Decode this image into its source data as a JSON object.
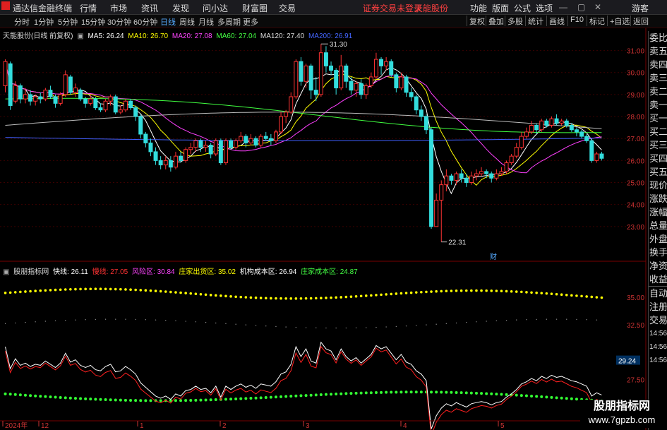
{
  "app": {
    "title": "通达信金融终端"
  },
  "menu": [
    "行情",
    "市场",
    "资讯",
    "发现",
    "问小达",
    "财富圈",
    "交易"
  ],
  "warning": "证券交易未登录",
  "stock_name_top": "天能股份",
  "right_menu": [
    "功能",
    "版面",
    "公式",
    "选项"
  ],
  "guest": "游客",
  "periods": [
    "分时",
    "1分钟",
    "5分钟",
    "15分钟",
    "30分钟",
    "60分钟",
    "日线",
    "周线",
    "月线",
    "多周期",
    "更多"
  ],
  "active_period": "日线",
  "tools": [
    "复权",
    "叠加",
    "多股",
    "统计",
    "画线",
    "F10",
    "标记",
    "+自选",
    "返回"
  ],
  "main_header": {
    "title": "天能股份(日线 前复权)",
    "ma": [
      {
        "label": "MA5: 26.24",
        "color": "#ffffff"
      },
      {
        "label": "MA10: 26.70",
        "color": "#ffff00"
      },
      {
        "label": "MA20: 27.08",
        "color": "#ff40ff"
      },
      {
        "label": "MA60: 27.04",
        "color": "#40ff40"
      },
      {
        "label": "MA120: 27.40",
        "color": "#dddddd"
      },
      {
        "label": "MA200: 26.91",
        "color": "#4060ff"
      }
    ]
  },
  "price_axis": [
    "31.00",
    "30.00",
    "29.00",
    "28.00",
    "27.00",
    "26.00",
    "25.00",
    "24.00",
    "23.00"
  ],
  "high_label": "31.30",
  "low_label": "22.31",
  "cai_label": "财",
  "ind_header": {
    "name": "股朋指标网",
    "items": [
      {
        "label": "快线: 26.11",
        "color": "#ffffff"
      },
      {
        "label": "慢线: 27.05",
        "color": "#ff3030"
      },
      {
        "label": "风险区: 30.84",
        "color": "#ff40ff"
      },
      {
        "label": "庄家出货区: 35.02",
        "color": "#ffff00"
      },
      {
        "label": "机构成本区: 26.94",
        "color": "#ffffff"
      },
      {
        "label": "庄家成本区: 24.87",
        "color": "#40ff40"
      }
    ]
  },
  "ind_axis": [
    "35.00",
    "32.50",
    "29.24",
    "27.50",
    "25.00"
  ],
  "ind_tag": "29.24",
  "date_axis": [
    "2024年",
    "12",
    "1",
    "2",
    "3",
    "4",
    "5"
  ],
  "side_labels": [
    "委比",
    "卖五",
    "卖四",
    "卖三",
    "卖二",
    "卖一",
    "买一",
    "买二",
    "买三",
    "买四",
    "买五",
    "现价",
    "涨跌",
    "涨幅",
    "总量",
    "外盘",
    "换手",
    "净资",
    "收益",
    "自动",
    "注册",
    "交易"
  ],
  "side_ticks": [
    "14:56",
    "14:56",
    "14:56",
    "14:56",
    "14:56",
    "14:56",
    "14:56"
  ],
  "watermark": {
    "line1": "股朋指标网",
    "line2": "www.7gpzb.com"
  },
  "chart_data": {
    "type": "candlestick",
    "y_range": [
      22,
      31.5
    ],
    "candles": [
      [
        29.4,
        30.5,
        30.6,
        29.1
      ],
      [
        30.4,
        28.5,
        30.5,
        28.3
      ],
      [
        28.7,
        29.4,
        29.6,
        28.6
      ],
      [
        29.4,
        28.8,
        29.5,
        28.6
      ],
      [
        28.8,
        29.0,
        29.3,
        28.6
      ],
      [
        29.0,
        28.7,
        29.2,
        28.5
      ],
      [
        28.7,
        28.9,
        29.0,
        28.5
      ],
      [
        28.9,
        28.8,
        29.1,
        28.6
      ],
      [
        28.8,
        29.2,
        29.3,
        28.7
      ],
      [
        29.2,
        28.9,
        29.4,
        28.8
      ],
      [
        28.9,
        28.6,
        29.0,
        28.4
      ],
      [
        28.6,
        29.0,
        29.1,
        28.5
      ],
      [
        29.0,
        29.9,
        30.1,
        28.9
      ],
      [
        29.8,
        29.1,
        29.9,
        29.0
      ],
      [
        29.1,
        29.3,
        29.5,
        28.9
      ],
      [
        29.2,
        28.8,
        29.3,
        28.7
      ],
      [
        28.8,
        28.6,
        28.9,
        28.4
      ],
      [
        28.6,
        28.8,
        29.0,
        28.5
      ],
      [
        28.8,
        28.4,
        28.9,
        28.3
      ],
      [
        28.4,
        28.3,
        28.6,
        28.2
      ],
      [
        28.3,
        28.7,
        28.8,
        28.2
      ],
      [
        28.7,
        28.9,
        29.0,
        28.5
      ],
      [
        28.9,
        28.2,
        29.0,
        28.1
      ],
      [
        28.2,
        28.3,
        28.5,
        28.1
      ],
      [
        28.3,
        28.7,
        28.8,
        28.2
      ],
      [
        28.7,
        28.4,
        28.8,
        28.3
      ],
      [
        28.4,
        28.0,
        28.5,
        27.8
      ],
      [
        28.0,
        27.2,
        28.1,
        27.0
      ],
      [
        27.2,
        26.8,
        27.3,
        26.6
      ],
      [
        26.8,
        26.4,
        27.0,
        26.2
      ],
      [
        26.4,
        26.0,
        26.6,
        25.8
      ],
      [
        26.0,
        25.8,
        26.2,
        25.6
      ],
      [
        25.8,
        26.0,
        26.2,
        25.6
      ],
      [
        26.0,
        25.7,
        26.2,
        25.5
      ],
      [
        25.7,
        26.2,
        26.4,
        25.6
      ],
      [
        26.2,
        26.0,
        26.4,
        25.9
      ],
      [
        26.0,
        26.5,
        26.6,
        25.9
      ],
      [
        26.5,
        26.6,
        26.8,
        26.3
      ],
      [
        26.6,
        26.9,
        27.0,
        26.4
      ],
      [
        26.9,
        26.6,
        27.0,
        26.4
      ],
      [
        26.6,
        26.7,
        26.9,
        26.4
      ],
      [
        26.7,
        26.3,
        26.8,
        26.1
      ],
      [
        26.3,
        26.9,
        27.0,
        26.2
      ],
      [
        26.9,
        25.9,
        27.0,
        25.8
      ],
      [
        25.9,
        26.9,
        27.0,
        25.8
      ],
      [
        26.9,
        26.6,
        27.0,
        26.5
      ],
      [
        26.6,
        26.9,
        27.0,
        26.5
      ],
      [
        26.9,
        27.1,
        27.3,
        26.8
      ],
      [
        27.1,
        26.8,
        27.2,
        26.6
      ],
      [
        26.8,
        27.0,
        27.2,
        26.7
      ],
      [
        27.0,
        26.7,
        27.1,
        26.6
      ],
      [
        26.7,
        27.1,
        27.2,
        26.6
      ],
      [
        27.1,
        27.0,
        27.3,
        26.9
      ],
      [
        27.0,
        26.9,
        27.2,
        26.7
      ],
      [
        26.9,
        27.3,
        27.4,
        26.8
      ],
      [
        27.3,
        28.0,
        28.2,
        27.2
      ],
      [
        28.0,
        28.2,
        28.3,
        27.7
      ],
      [
        28.2,
        28.9,
        29.1,
        28.1
      ],
      [
        28.9,
        30.5,
        30.6,
        28.8
      ],
      [
        30.5,
        29.6,
        30.7,
        29.4
      ],
      [
        29.6,
        30.3,
        30.4,
        29.3
      ],
      [
        30.3,
        29.2,
        30.4,
        28.8
      ],
      [
        29.2,
        29.0,
        29.8,
        28.7
      ],
      [
        29.0,
        30.9,
        31.3,
        28.9
      ],
      [
        30.9,
        30.3,
        31.2,
        30.0
      ],
      [
        30.3,
        30.1,
        30.5,
        29.9
      ],
      [
        30.1,
        29.3,
        30.2,
        29.0
      ],
      [
        29.3,
        30.3,
        30.8,
        29.2
      ],
      [
        30.3,
        29.6,
        30.4,
        29.3
      ],
      [
        29.6,
        29.2,
        29.8,
        29.0
      ],
      [
        29.2,
        29.5,
        29.6,
        28.9
      ],
      [
        29.5,
        29.0,
        29.7,
        28.8
      ],
      [
        29.0,
        29.4,
        29.5,
        28.8
      ],
      [
        29.4,
        29.8,
        30.0,
        29.3
      ],
      [
        29.8,
        30.6,
        30.9,
        29.7
      ],
      [
        30.6,
        30.3,
        30.7,
        29.9
      ],
      [
        30.3,
        30.5,
        30.7,
        30.1
      ],
      [
        30.5,
        29.9,
        30.6,
        29.8
      ],
      [
        29.9,
        29.3,
        30.0,
        29.1
      ],
      [
        29.3,
        29.8,
        30.0,
        29.2
      ],
      [
        29.8,
        29.1,
        29.9,
        28.9
      ],
      [
        29.1,
        28.9,
        29.3,
        28.7
      ],
      [
        28.9,
        28.3,
        29.0,
        28.1
      ],
      [
        28.3,
        28.0,
        28.5,
        27.8
      ],
      [
        28.0,
        27.4,
        28.1,
        27.2
      ],
      [
        27.4,
        23.0,
        27.5,
        22.9
      ],
      [
        23.0,
        24.2,
        24.5,
        23.1
      ],
      [
        24.2,
        24.9,
        25.1,
        22.3
      ],
      [
        24.9,
        25.3,
        25.6,
        24.6
      ],
      [
        25.3,
        25.1,
        25.4,
        24.9
      ],
      [
        25.1,
        25.4,
        25.5,
        24.9
      ],
      [
        25.4,
        25.2,
        25.6,
        25.0
      ],
      [
        25.2,
        25.0,
        25.4,
        24.8
      ],
      [
        25.0,
        25.3,
        25.5,
        24.9
      ],
      [
        25.3,
        25.4,
        25.6,
        25.1
      ],
      [
        25.4,
        25.5,
        25.7,
        25.3
      ],
      [
        25.5,
        25.4,
        25.6,
        25.2
      ],
      [
        25.4,
        25.2,
        25.5,
        25.0
      ],
      [
        25.2,
        25.4,
        25.6,
        25.1
      ],
      [
        25.4,
        25.5,
        25.7,
        25.3
      ],
      [
        25.5,
        25.9,
        26.0,
        25.4
      ],
      [
        25.9,
        26.2,
        26.3,
        25.8
      ],
      [
        26.2,
        26.6,
        26.8,
        26.1
      ],
      [
        26.6,
        27.1,
        27.3,
        26.5
      ],
      [
        27.1,
        27.3,
        27.5,
        27.0
      ],
      [
        27.3,
        27.6,
        27.8,
        27.2
      ],
      [
        27.6,
        27.4,
        27.7,
        27.2
      ],
      [
        27.4,
        27.8,
        27.9,
        27.3
      ],
      [
        27.8,
        27.6,
        27.9,
        27.5
      ],
      [
        27.6,
        27.9,
        28.0,
        27.5
      ],
      [
        27.9,
        27.7,
        28.1,
        27.6
      ],
      [
        27.7,
        27.8,
        27.9,
        27.6
      ],
      [
        27.8,
        27.6,
        27.9,
        27.5
      ],
      [
        27.6,
        27.4,
        27.7,
        27.3
      ],
      [
        27.4,
        27.3,
        27.5,
        27.1
      ],
      [
        27.3,
        27.1,
        27.4,
        27.0
      ],
      [
        27.1,
        26.9,
        27.2,
        26.8
      ],
      [
        26.9,
        26.0,
        27.0,
        25.9
      ],
      [
        26.0,
        26.3,
        26.4,
        25.9
      ],
      [
        26.3,
        26.1,
        26.4,
        26.0
      ]
    ],
    "indicator": {
      "y_range": [
        24,
        37
      ]
    }
  }
}
